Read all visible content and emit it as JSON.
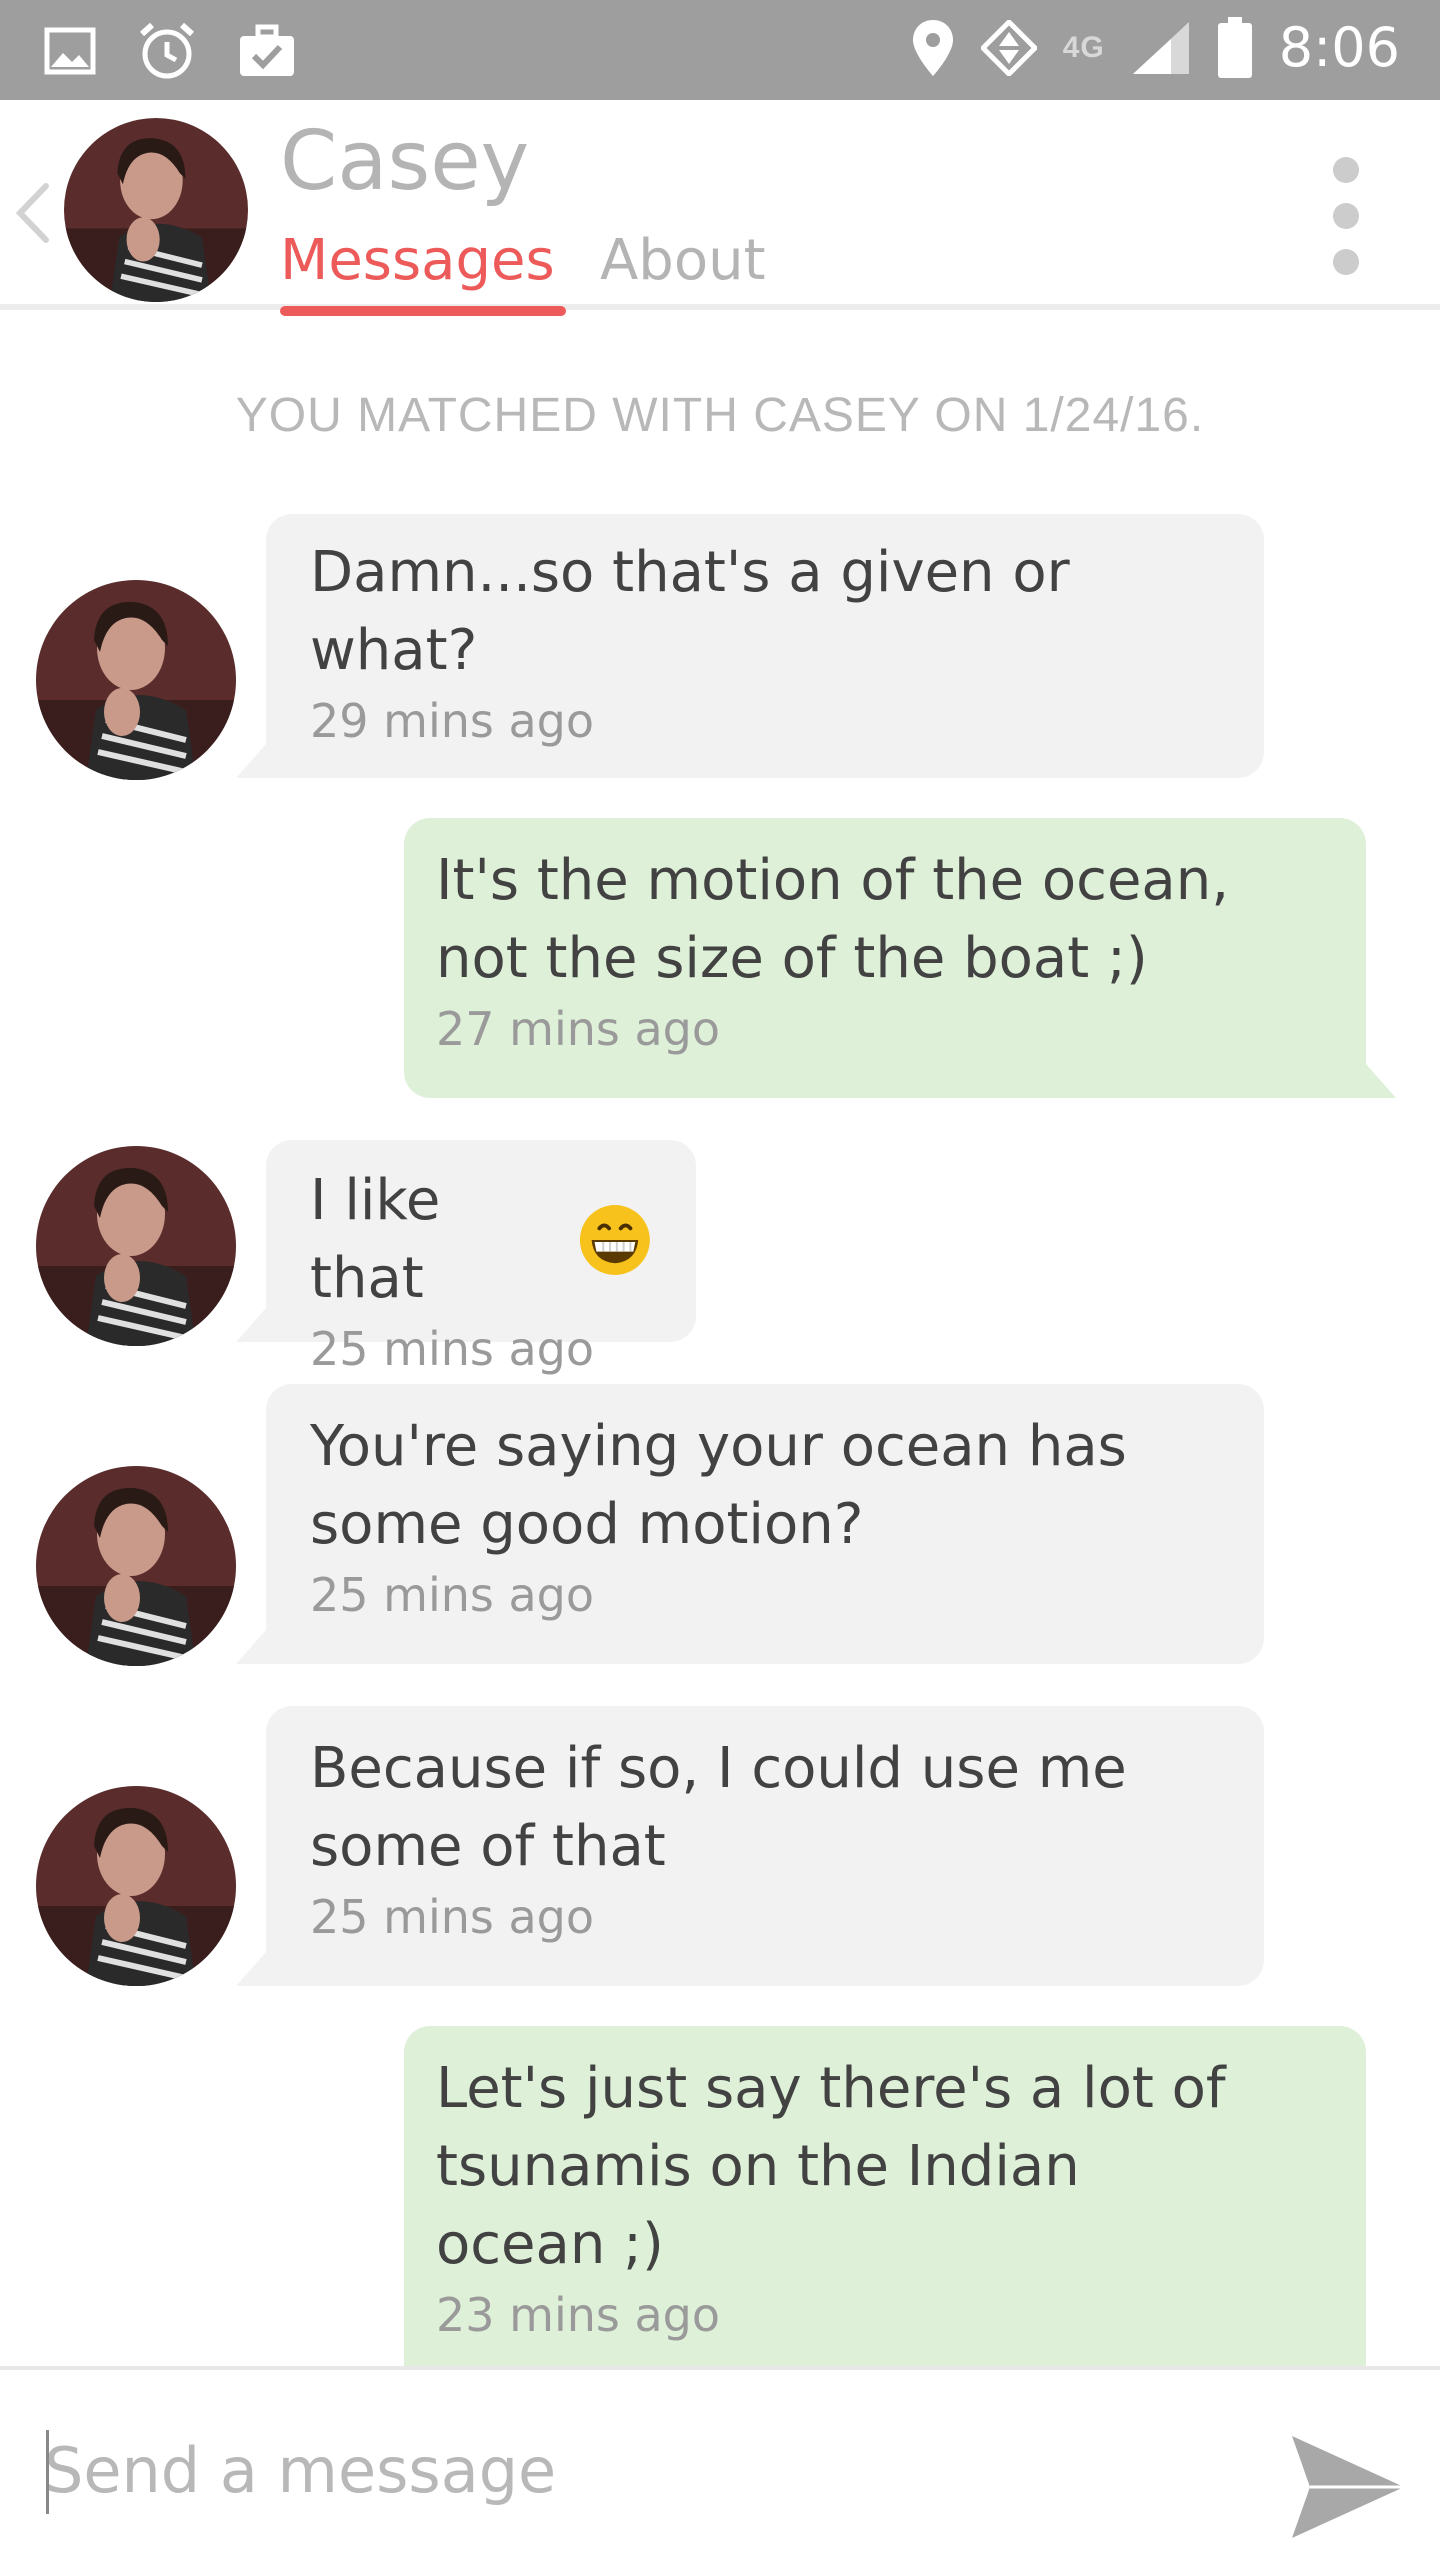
{
  "status_bar": {
    "time": "8:06",
    "network": "4G",
    "left_icons": [
      "image-icon",
      "alarm-icon",
      "briefcase-check-icon"
    ],
    "right_icons": [
      "location-pin-icon",
      "data-transfer-icon",
      "signal-icon",
      "battery-icon"
    ]
  },
  "header": {
    "name": "Casey",
    "tabs": [
      {
        "label": "Messages",
        "active": true
      },
      {
        "label": "About",
        "active": false
      }
    ]
  },
  "match_text": "YOU MATCHED WITH CASEY ON 1/24/16.",
  "messages": [
    {
      "direction": "in",
      "lines": [
        "Damn...so that's a given or",
        "what?"
      ],
      "time": "29 mins ago"
    },
    {
      "direction": "out",
      "lines": [
        "It's the motion of the ocean,",
        "not the size of the boat ;)"
      ],
      "time": "27 mins ago"
    },
    {
      "direction": "in",
      "lines": [
        "I like that"
      ],
      "emoji": "grinning-face-emoji",
      "time": "25 mins ago"
    },
    {
      "direction": "in",
      "lines": [
        "You're saying your ocean has",
        "some good motion?"
      ],
      "time": "25 mins ago"
    },
    {
      "direction": "in",
      "lines": [
        "Because if so, I could use me",
        "some of that"
      ],
      "time": "25 mins ago"
    },
    {
      "direction": "out",
      "lines": [
        "Let's just say there's a lot of",
        "tsunamis on the Indian",
        "ocean ;)"
      ],
      "time": "23 mins ago"
    }
  ],
  "composer": {
    "placeholder": "Send a message"
  },
  "colors": {
    "accent": "#ed5a5a",
    "incoming_bubble": "#f2f2f2",
    "outgoing_bubble": "#def1d8",
    "status_bar": "#9e9e9e"
  }
}
